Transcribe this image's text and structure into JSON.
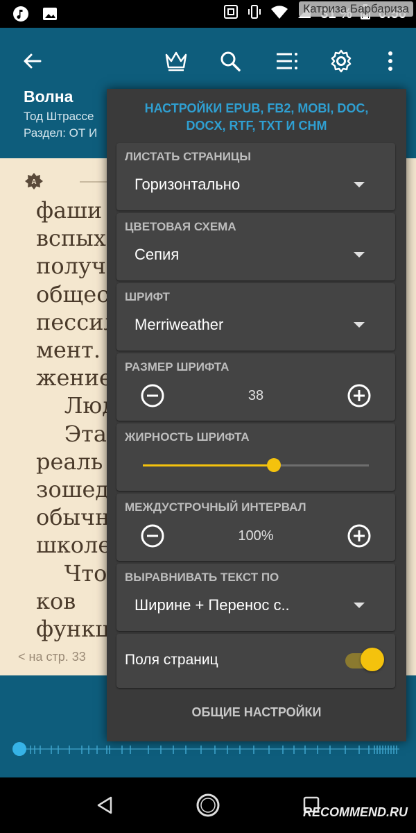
{
  "status_bar": {
    "overlay_name": "Катриза Барбариза",
    "battery": "31 %",
    "time": "0:50",
    "icons": [
      "music-note-icon",
      "image-icon",
      "nfc-icon",
      "vibrate-icon",
      "wifi-icon",
      "signal-icon",
      "battery-icon"
    ]
  },
  "app_bar": {
    "icons": [
      "back-arrow-icon",
      "crown-icon",
      "search-icon",
      "toc-icon",
      "gear-icon",
      "more-vert-icon"
    ]
  },
  "book": {
    "title": "Волна",
    "author": "Тод Штрассе",
    "section": "Раздел: ОТ И"
  },
  "reader": {
    "lines": [
      "фаши",
      "вспых",
      "получ",
      "общес",
      "пессил",
      "мент.",
      "жение",
      "    Люд",
      "    Эта",
      "реаль",
      "зошед",
      "обычн",
      "школе",
      "    Что",
      "ков",
      "функц"
    ],
    "page_indicator": "< на стр. 33",
    "badge": "A"
  },
  "panel": {
    "title": "НАСТРОЙКИ EPUB, FB2, MOBI, DOC, DOCX, RTF, TXT И CHM",
    "page_turn": {
      "label": "ЛИСТАТЬ СТРАНИЦЫ",
      "value": "Горизонтально"
    },
    "color_scheme": {
      "label": "ЦВЕТОВАЯ СХЕМА",
      "value": "Сепия"
    },
    "font": {
      "label": "ШРИФТ",
      "value": "Merriweather"
    },
    "font_size": {
      "label": "РАЗМЕР ШРИФТА",
      "value": "38"
    },
    "font_weight": {
      "label": "ЖИРНОСТЬ ШРИФТА",
      "level": 0.58
    },
    "line_spacing": {
      "label": "МЕЖДУСТРОЧНЫЙ ИНТЕРВАЛ",
      "value": "100%"
    },
    "alignment": {
      "label": "ВЫРАВНИВАТЬ ТЕКСТ ПО",
      "value": "Ширине + Перенос с.."
    },
    "margins": {
      "label": "Поля страниц",
      "on": true
    },
    "general": "ОБЩИЕ НАСТРОЙКИ"
  },
  "watermark": "RECOMMEND.RU",
  "seek": {
    "position": 0.0
  },
  "colors": {
    "app_bar": "#0e5d7c",
    "page": "#f4e7cf",
    "panel": "#3a3a3a",
    "card": "#444444",
    "accent_title": "#2f9fd1",
    "accent_control": "#f4c20d"
  }
}
